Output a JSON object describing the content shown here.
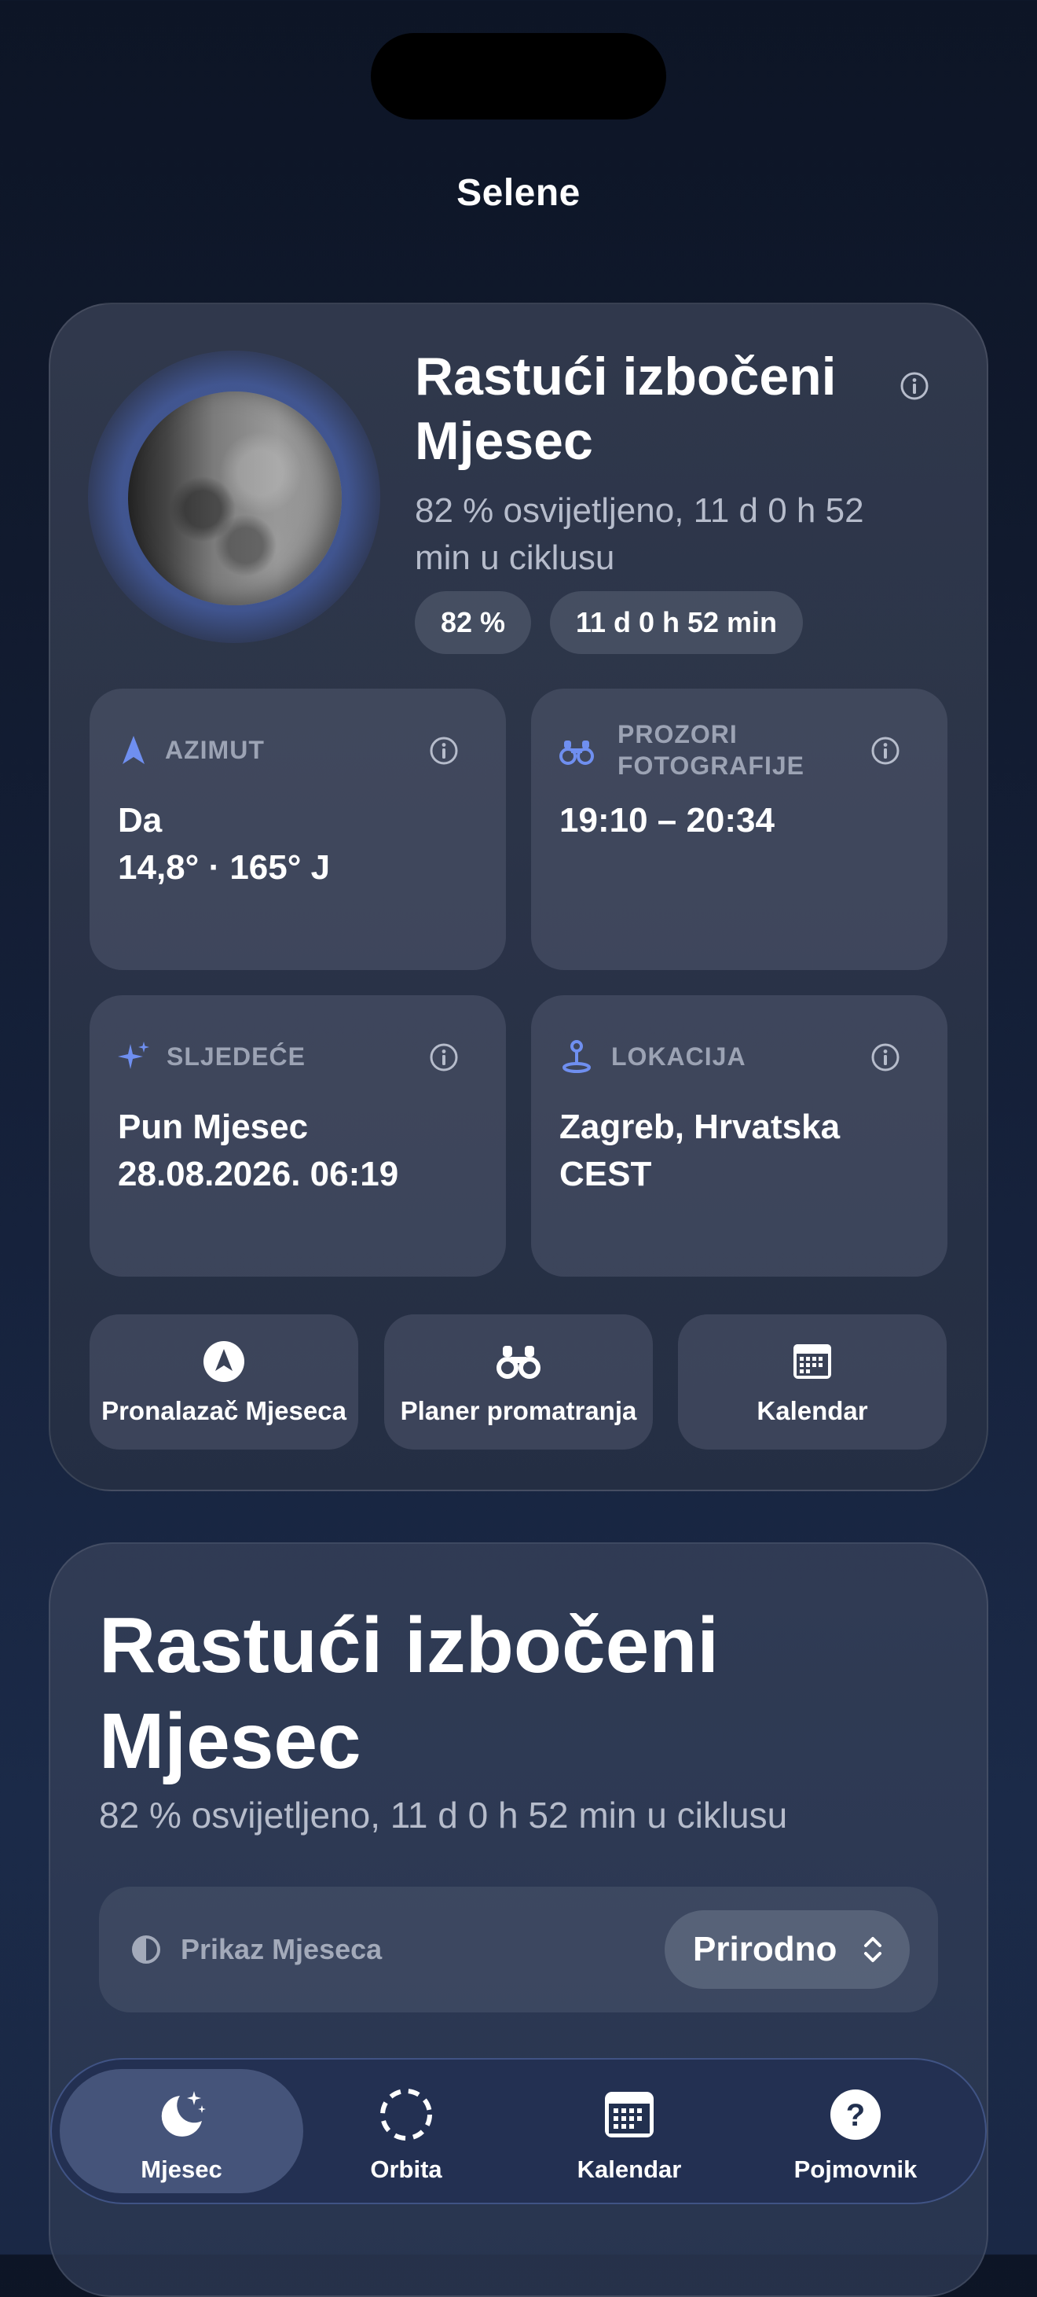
{
  "app": {
    "title": "Selene"
  },
  "phase": {
    "name": "Rastući izbočeni Mjesec",
    "subtitle": "82 % osvijetljeno, 11 d 0 h 52 min u ciklusu",
    "chips": [
      "82 %",
      "11 d 0 h 52 min"
    ],
    "illumination_fraction": 0.82
  },
  "tiles": {
    "azimuth": {
      "label": "AZIMUT",
      "value1": "Da",
      "value2": "14,8° · 165° J"
    },
    "photo": {
      "label_line1": "PROZORI",
      "label_line2": "FOTOGRAFIJE",
      "value1": "19:10 – 20:34"
    },
    "next": {
      "label": "SLJEDEĆE",
      "value1": "Pun Mjesec",
      "value2": "28.08.2026. 06:19"
    },
    "location": {
      "label": "LOKACIJA",
      "value1": "Zagreb, Hrvatska",
      "value2": "CEST"
    }
  },
  "actions": {
    "finder": "Pronalazač Mjeseca",
    "planner": "Planer promatranja",
    "calendar": "Kalendar"
  },
  "detail": {
    "title": "Rastući izbočeni Mjesec",
    "subtitle": "82 % osvijetljeno, 11 d 0 h 52 min u ciklusu",
    "view_label": "Prikaz Mjeseca",
    "view_value": "Prirodno"
  },
  "tabbar": {
    "tabs": [
      {
        "label": "Mjesec",
        "icon": "moon-stars-icon",
        "active": true
      },
      {
        "label": "Orbita",
        "icon": "orbit-icon",
        "active": false
      },
      {
        "label": "Kalendar",
        "icon": "calendar-icon",
        "active": false
      },
      {
        "label": "Pojmovnik",
        "icon": "question-icon",
        "active": false
      }
    ]
  },
  "colors": {
    "accent": "#6f8ff0",
    "background": "#111a2e",
    "card": "#2e3649"
  }
}
